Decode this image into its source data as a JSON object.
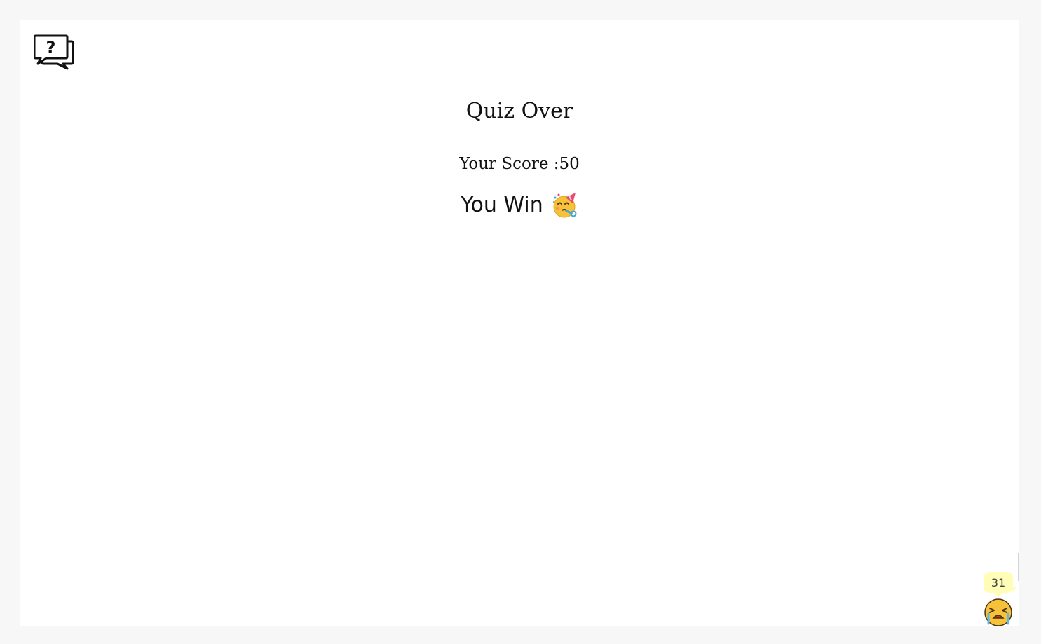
{
  "app": {
    "logo_icon": "question-chat-bubbles-icon"
  },
  "quiz": {
    "title": "Quiz Over",
    "score_text": "Your Score :50",
    "result_text": "You Win",
    "result_icon": "partying-face-icon"
  },
  "timer": {
    "value": "31",
    "face_icon": "crying-face-icon",
    "tooltip_color": "#fffdb8"
  }
}
